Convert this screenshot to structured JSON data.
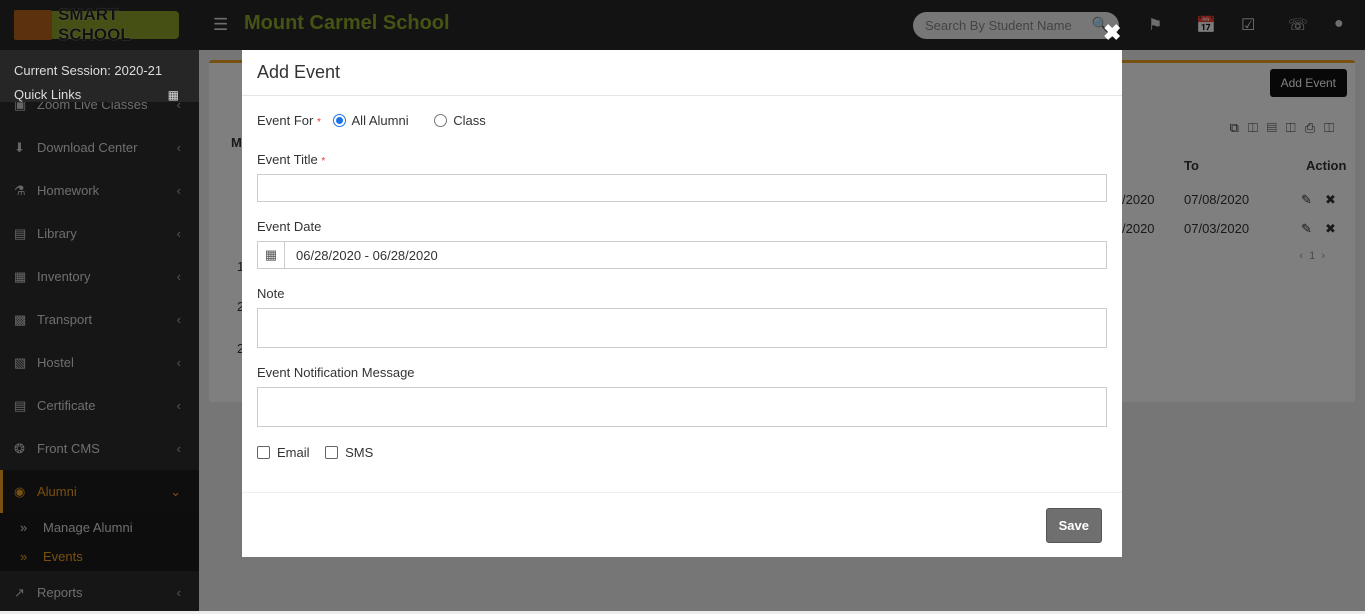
{
  "header": {
    "logo_text": "SMART SCHOOL",
    "school_name": "Mount Carmel School",
    "search_placeholder": "Search By Student Name"
  },
  "sidebar": {
    "session": "Current Session: 2020-21",
    "quick_links": "Quick Links",
    "items": [
      {
        "label": "Zoom Live Classes",
        "icon": "video-icon"
      },
      {
        "label": "Download Center",
        "icon": "download-icon"
      },
      {
        "label": "Homework",
        "icon": "flask-icon"
      },
      {
        "label": "Library",
        "icon": "book-icon"
      },
      {
        "label": "Inventory",
        "icon": "inventory-icon"
      },
      {
        "label": "Transport",
        "icon": "bus-icon"
      },
      {
        "label": "Hostel",
        "icon": "building-icon"
      },
      {
        "label": "Certificate",
        "icon": "certificate-icon"
      },
      {
        "label": "Front CMS",
        "icon": "cms-icon"
      },
      {
        "label": "Alumni",
        "icon": "alumni-icon"
      },
      {
        "label": "Reports",
        "icon": "chart-icon"
      }
    ],
    "alumni_sub": [
      "Manage Alumni",
      "Events"
    ]
  },
  "background": {
    "add_event": "Add Event",
    "col_to": "To",
    "col_action": "Action",
    "rows": [
      {
        "from": "/2020",
        "to": "07/08/2020"
      },
      {
        "from": "/2020",
        "to": "07/03/2020"
      }
    ],
    "page": "1",
    "col_partial": "M",
    "left_partial": [
      "1",
      "2",
      "2"
    ]
  },
  "modal": {
    "title": "Add Event",
    "event_for": "Event For",
    "opt_all": "All Alumni",
    "opt_class": "Class",
    "event_title": "Event Title",
    "event_date": "Event Date",
    "date_value": "06/28/2020 - 06/28/2020",
    "note": "Note",
    "notif": "Event Notification Message",
    "email": "Email",
    "sms": "SMS",
    "save": "Save",
    "required": "*"
  }
}
